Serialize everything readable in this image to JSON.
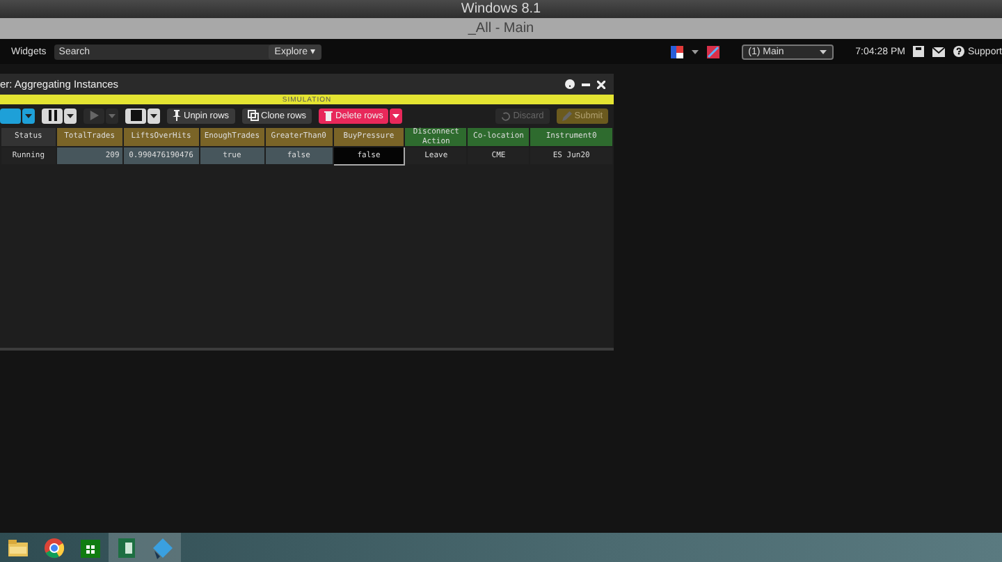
{
  "window": {
    "title": "Windows 8.1",
    "subtitle": "_All - Main"
  },
  "app_toolbar": {
    "widgets_label": "Widgets",
    "search": {
      "placeholder": "Search"
    },
    "explore": "Explore ▾",
    "layout": "(1) Main",
    "time": "7:04:28 PM",
    "support": "Support"
  },
  "panel": {
    "title": "er: Aggregating Instances",
    "mode_banner": "SIMULATION",
    "toolbar": [
      {
        "kind": "split",
        "disabled": false
      },
      {
        "kind": "split",
        "disabled": false
      },
      {
        "kind": "split",
        "disabled": true
      },
      {
        "kind": "split",
        "disabled": false
      },
      {
        "kind": "button",
        "label": "Unpin rows",
        "disabled": false
      },
      {
        "kind": "button",
        "label": "Clone rows",
        "disabled": false
      },
      {
        "kind": "split",
        "label": "Delete rows",
        "disabled": false
      },
      {
        "kind": "spacer"
      },
      {
        "kind": "button",
        "label": "Discard",
        "disabled": true
      },
      {
        "kind": "button",
        "label": "Submit",
        "disabled": true
      }
    ],
    "table": {
      "columns": [
        {
          "label": "Status",
          "kind": "plain"
        },
        {
          "label": "TotalTrades",
          "kind": "variable"
        },
        {
          "label": "LiftsOverHits",
          "kind": "variable"
        },
        {
          "label": "EnoughTrades",
          "kind": "variable"
        },
        {
          "label": "GreaterThan0",
          "kind": "variable"
        },
        {
          "label": "BuyPressure",
          "kind": "variable"
        },
        {
          "label": "Disconnect Action",
          "kind": "setting"
        },
        {
          "label": "Co-location",
          "kind": "setting"
        },
        {
          "label": "Instrument0",
          "kind": "setting"
        }
      ],
      "rows": [
        {
          "cells": [
            {
              "text": "Running",
              "selected": false,
              "focused": false
            },
            {
              "text": "209",
              "selected": true,
              "focused": false
            },
            {
              "text": "0.990476190476",
              "selected": true,
              "focused": false
            },
            {
              "text": "true",
              "selected": true,
              "focused": false
            },
            {
              "text": "false",
              "selected": true,
              "focused": false
            },
            {
              "text": "false",
              "selected": false,
              "focused": true
            },
            {
              "text": "Leave",
              "selected": false,
              "focused": false
            },
            {
              "text": "CME",
              "selected": false,
              "focused": false
            },
            {
              "text": "ES Jun20",
              "selected": false,
              "focused": false
            }
          ]
        }
      ]
    }
  },
  "taskbar": {
    "apps": [
      {
        "kind": "folder",
        "active": false
      },
      {
        "kind": "browser",
        "active": false
      },
      {
        "kind": "store",
        "active": false
      },
      {
        "kind": "sheet",
        "active": true
      },
      {
        "kind": "diamond",
        "active": true
      }
    ]
  }
}
